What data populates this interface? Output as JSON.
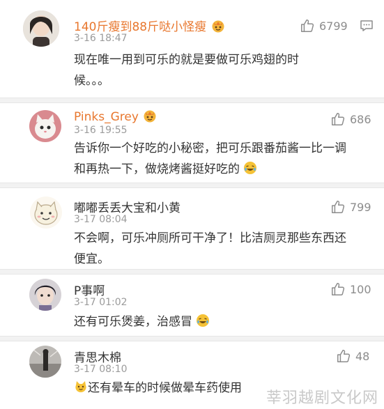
{
  "comments": [
    {
      "username": "140斤瘦到88斤哒小怪瘦",
      "time": "3-16 18:47",
      "likes": "6799",
      "text_line1": "现在唯一用到可乐的就是要做可乐鸡翅的时",
      "text_line2": "候。。。"
    },
    {
      "username": "Pinks_Grey",
      "time": "3-16 19:55",
      "likes": "686",
      "text_line1": "告诉你一个好吃的小秘密，把可乐跟番茄酱一比一调",
      "text_line2": "和再热一下，做烧烤酱挺好吃的"
    },
    {
      "username": "嘟嘟丢丢大宝和小黄",
      "time": "3-17 08:04",
      "likes": "799",
      "text_line1": "不会啊，可乐冲厕所可干净了！比洁厕灵那些东西还",
      "text_line2": "便宜。"
    },
    {
      "username": "P事啊",
      "time": "3-17 01:02",
      "likes": "100",
      "text_line1": "还有可乐煲姜，治感冒"
    },
    {
      "username": "青思木棉",
      "time": "3-17 08:10",
      "likes": "48",
      "text_line1": "还有晕车的时候做晕车药使用"
    }
  ],
  "watermark": "莘羽越剧文化网",
  "colors": {
    "vip_name": "#e8772e",
    "text": "#333333",
    "meta": "#9b9b9b",
    "separator": "#f2f2f2"
  },
  "icons": {
    "like": "thumbs-up-icon",
    "reply": "comment-icon",
    "vip_badge": "crown-emoji-icon",
    "laugh": "laughing-emoji-icon",
    "cat": "cat-emoji-icon"
  }
}
